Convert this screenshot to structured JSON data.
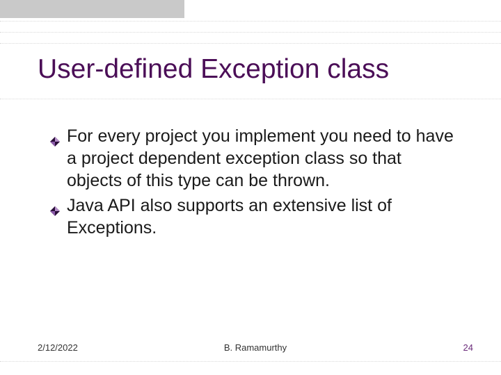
{
  "title": "User-defined Exception class",
  "bullets": [
    "For every project you implement you need to have a project dependent exception class so that objects of this type can be thrown.",
    "Java API also supports an extensive list of Exceptions."
  ],
  "footer": {
    "date": "2/12/2022",
    "author": "B. Ramamurthy",
    "page": "24"
  },
  "colors": {
    "title": "#4b0e57",
    "bullet_dark": "#2a0d3a",
    "bullet_light": "#b58fc9"
  }
}
